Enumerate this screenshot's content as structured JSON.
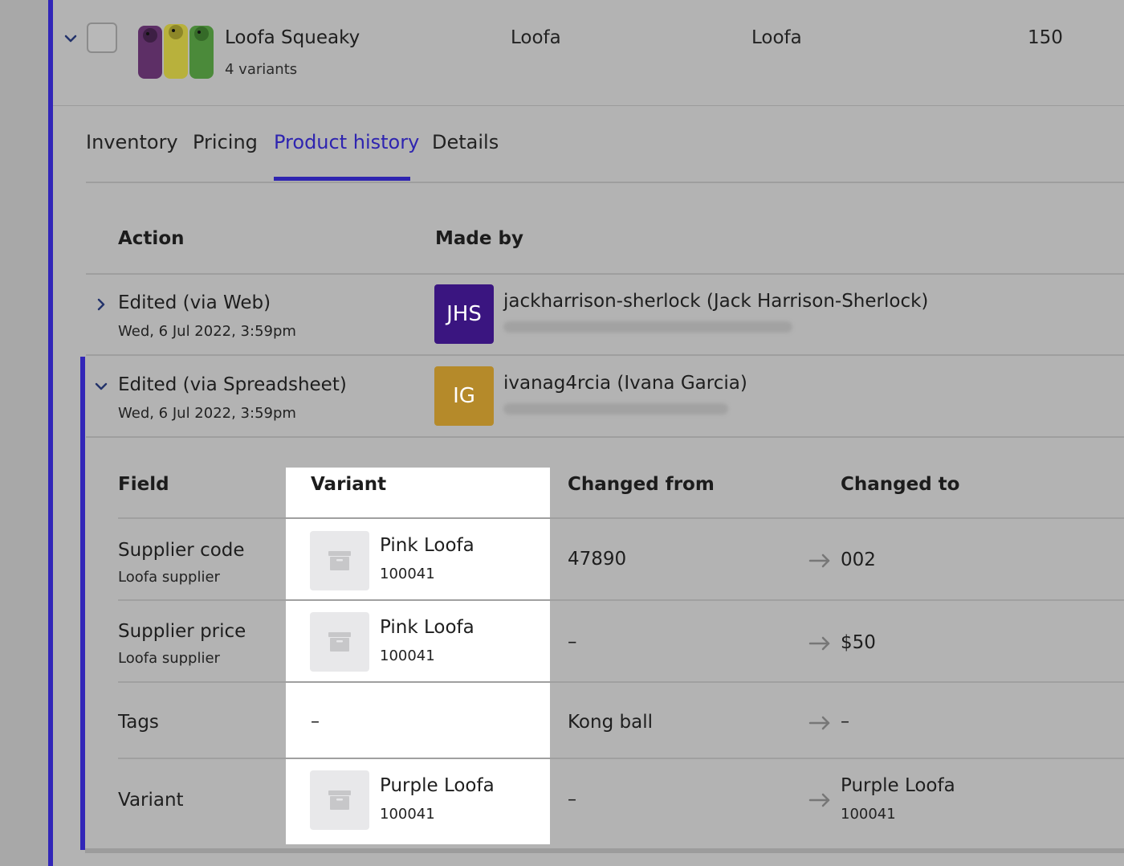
{
  "product": {
    "name": "Loofa Squeaky",
    "variants_label": "4 variants",
    "col_a": "Loofa",
    "col_b": "Loofa",
    "col_c": "150"
  },
  "tabs": [
    {
      "label": "Inventory",
      "active": false
    },
    {
      "label": "Pricing",
      "active": false
    },
    {
      "label": "Product history",
      "active": true
    },
    {
      "label": "Details",
      "active": false
    }
  ],
  "history": {
    "headers": {
      "action": "Action",
      "made_by": "Made by"
    },
    "rows": [
      {
        "action": "Edited (via Web)",
        "date": "Wed, 6 Jul 2022, 3:59pm",
        "avatar_initials": "JHS",
        "avatar_color": "#3a1580",
        "user": "jackharrison-sherlock (Jack Harrison-Sherlock)",
        "expanded": false
      },
      {
        "action": "Edited (via Spreadsheet)",
        "date": "Wed, 6 Jul 2022, 3:59pm",
        "avatar_initials": "IG",
        "avatar_color": "#b58a2a",
        "user": "ivanag4rcia (Ivana Garcia)",
        "expanded": true
      }
    ]
  },
  "details": {
    "headers": {
      "field": "Field",
      "variant": "Variant",
      "changed_from": "Changed from",
      "changed_to": "Changed to"
    },
    "rows": [
      {
        "field": "Supplier code",
        "field_sub": "Loofa supplier",
        "variant_name": "Pink Loofa",
        "variant_sku": "100041",
        "from": "47890",
        "to": "002",
        "to_sub": ""
      },
      {
        "field": "Supplier price",
        "field_sub": "Loofa supplier",
        "variant_name": "Pink Loofa",
        "variant_sku": "100041",
        "from": "–",
        "to": "$50",
        "to_sub": ""
      },
      {
        "field": "Tags",
        "field_sub": "",
        "variant_name": "–",
        "variant_sku": "",
        "from": "Kong ball",
        "to": "–",
        "to_sub": ""
      },
      {
        "field": "Variant",
        "field_sub": "",
        "variant_name": "Purple Loofa",
        "variant_sku": "100041",
        "from": "–",
        "to": "Purple Loofa",
        "to_sub": "100041"
      }
    ]
  },
  "colors": {
    "accent": "#2e24b0",
    "highlight_column": "#ffffff",
    "overlay_gray": "#b3b3b3"
  }
}
